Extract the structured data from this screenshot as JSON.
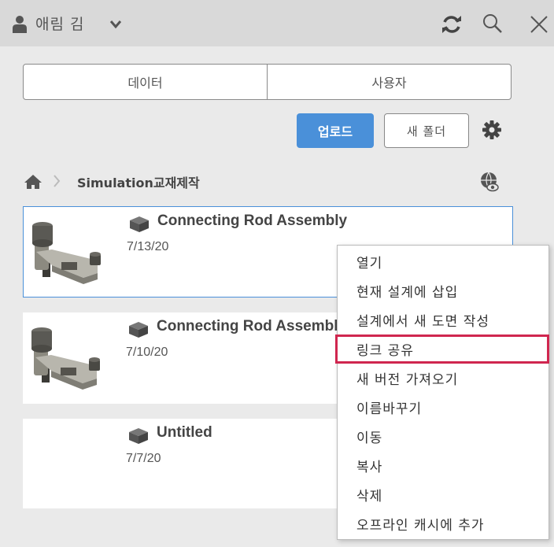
{
  "header": {
    "user_name": "애림 김",
    "icons": [
      "user-icon",
      "chevron-down-icon",
      "refresh-icon",
      "search-icon",
      "close-icon"
    ]
  },
  "tabs": [
    {
      "label": "데이터"
    },
    {
      "label": "사용자"
    }
  ],
  "toolbar": {
    "upload_label": "업로드",
    "new_folder_label": "새 폴더",
    "accent_color": "#4a90d9"
  },
  "breadcrumb": {
    "folder": "Simulation교재제작"
  },
  "items": [
    {
      "title": "Connecting Rod Assembly",
      "date": "7/13/20"
    },
    {
      "title": "Connecting Rod Assembly",
      "date": "7/10/20"
    },
    {
      "title": "Untitled",
      "date": "7/7/20"
    }
  ],
  "context_menu": {
    "items": [
      {
        "label": "열기"
      },
      {
        "label": "현재 설계에 삽입"
      },
      {
        "label": "설계에서 새 도면 작성"
      },
      {
        "label": "링크 공유"
      },
      {
        "label": "새 버전 가져오기"
      },
      {
        "label": "이름바꾸기"
      },
      {
        "label": "이동"
      },
      {
        "label": "복사"
      },
      {
        "label": "삭제"
      },
      {
        "label": "오프라인 캐시에 추가"
      }
    ],
    "highlight_color": "#d0264f"
  }
}
